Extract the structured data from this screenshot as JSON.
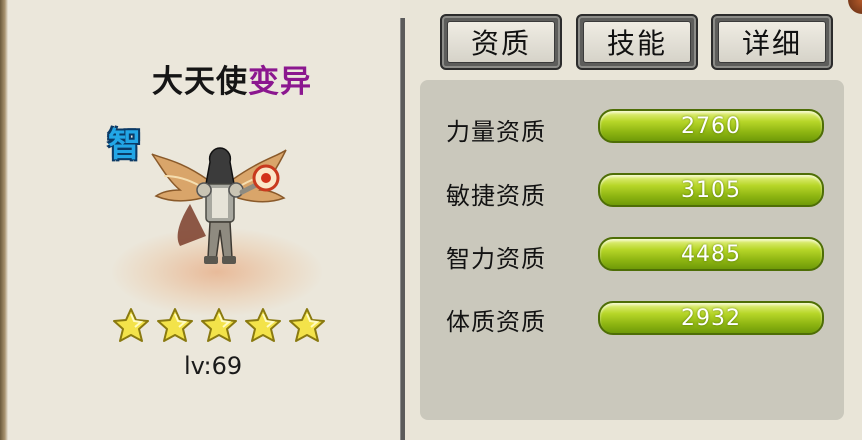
{
  "pet": {
    "name": "大天使",
    "variant": "变异",
    "type_badge": "智",
    "star_count": 5,
    "level_text": "lv:69"
  },
  "tabs": [
    {
      "label": "资质",
      "active": true
    },
    {
      "label": "技能",
      "active": false
    },
    {
      "label": "详细",
      "active": false
    }
  ],
  "stats": [
    {
      "label": "力量资质",
      "value": "2760"
    },
    {
      "label": "敏捷资质",
      "value": "3105"
    },
    {
      "label": "智力资质",
      "value": "4485"
    },
    {
      "label": "体质资质",
      "value": "2932"
    }
  ],
  "colors": {
    "variant_text": "#8b178f",
    "badge": "#22a6e6",
    "bar": "#9fc41a"
  }
}
